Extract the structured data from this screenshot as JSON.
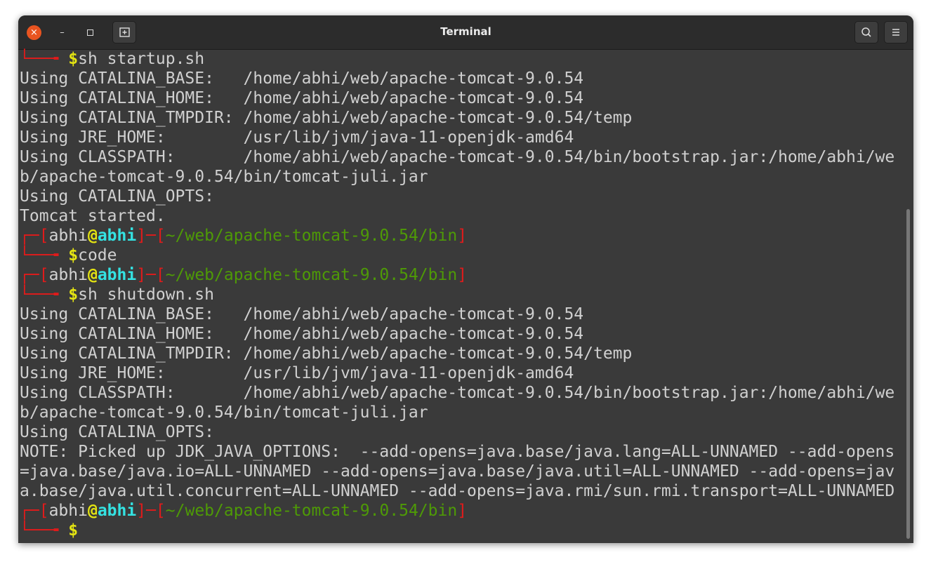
{
  "window": {
    "title": "Terminal"
  },
  "titlebar": {
    "close_glyph": "×",
    "minimize_glyph": "–"
  },
  "terminal": {
    "prompt": {
      "user": "abhi",
      "at": "@",
      "host": "abhi",
      "path": "~/web/apache-tomcat-9.0.54/bin",
      "dollar": "$"
    },
    "lines": [
      {
        "kind": "cmd",
        "text": "sh startup.sh"
      },
      {
        "kind": "out",
        "text": "Using CATALINA_BASE:   /home/abhi/web/apache-tomcat-9.0.54"
      },
      {
        "kind": "out",
        "text": "Using CATALINA_HOME:   /home/abhi/web/apache-tomcat-9.0.54"
      },
      {
        "kind": "out",
        "text": "Using CATALINA_TMPDIR: /home/abhi/web/apache-tomcat-9.0.54/temp"
      },
      {
        "kind": "out",
        "text": "Using JRE_HOME:        /usr/lib/jvm/java-11-openjdk-amd64"
      },
      {
        "kind": "out",
        "text": "Using CLASSPATH:       /home/abhi/web/apache-tomcat-9.0.54/bin/bootstrap.jar:/home/abhi/we"
      },
      {
        "kind": "out",
        "text": "b/apache-tomcat-9.0.54/bin/tomcat-juli.jar"
      },
      {
        "kind": "out",
        "text": "Using CATALINA_OPTS:"
      },
      {
        "kind": "out",
        "text": "Tomcat started."
      },
      {
        "kind": "prompt"
      },
      {
        "kind": "cmd",
        "text": "code"
      },
      {
        "kind": "prompt"
      },
      {
        "kind": "cmd",
        "text": "sh shutdown.sh"
      },
      {
        "kind": "out",
        "text": "Using CATALINA_BASE:   /home/abhi/web/apache-tomcat-9.0.54"
      },
      {
        "kind": "out",
        "text": "Using CATALINA_HOME:   /home/abhi/web/apache-tomcat-9.0.54"
      },
      {
        "kind": "out",
        "text": "Using CATALINA_TMPDIR: /home/abhi/web/apache-tomcat-9.0.54/temp"
      },
      {
        "kind": "out",
        "text": "Using JRE_HOME:        /usr/lib/jvm/java-11-openjdk-amd64"
      },
      {
        "kind": "out",
        "text": "Using CLASSPATH:       /home/abhi/web/apache-tomcat-9.0.54/bin/bootstrap.jar:/home/abhi/we"
      },
      {
        "kind": "out",
        "text": "b/apache-tomcat-9.0.54/bin/tomcat-juli.jar"
      },
      {
        "kind": "out",
        "text": "Using CATALINA_OPTS:"
      },
      {
        "kind": "out",
        "text": "NOTE: Picked up JDK_JAVA_OPTIONS:  --add-opens=java.base/java.lang=ALL-UNNAMED --add-opens"
      },
      {
        "kind": "out",
        "text": "=java.base/java.io=ALL-UNNAMED --add-opens=java.base/java.util=ALL-UNNAMED --add-opens=jav"
      },
      {
        "kind": "out",
        "text": "a.base/java.util.concurrent=ALL-UNNAMED --add-opens=java.rmi/sun.rmi.transport=ALL-UNNAMED"
      },
      {
        "kind": "prompt"
      },
      {
        "kind": "cmd",
        "text": ""
      }
    ]
  }
}
